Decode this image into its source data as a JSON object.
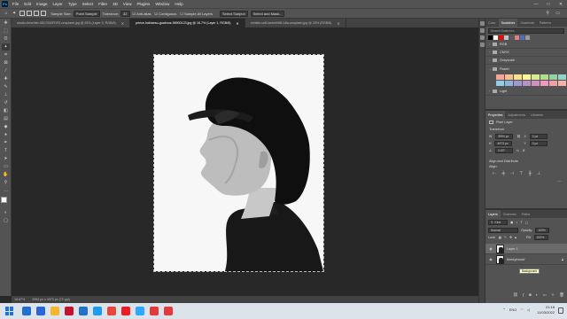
{
  "menu": {
    "app_badge": "Ps",
    "items": [
      "File",
      "Edit",
      "Image",
      "Layer",
      "Type",
      "Select",
      "Filter",
      "3D",
      "View",
      "Plugins",
      "Window",
      "Help"
    ],
    "window_controls": [
      "—",
      "□",
      "✕"
    ]
  },
  "options_bar": {
    "sample_size_label": "Sample Size:",
    "sample_size_value": "Point Sample",
    "tolerance_label": "Tolerance:",
    "tolerance_value": "32",
    "anti_alias": "Anti-alias",
    "contiguous": "Contiguous",
    "sample_all_layers": "Sample All Layers",
    "select_subject": "Select Subject",
    "select_and_mask": "Select and Mask..."
  },
  "document_tabs": [
    {
      "title": "studio-benchter-0817000FDFE-unsplash.jpg @ 25% (Layer 0, RGB/8)",
      "active": false
    },
    {
      "title": "prince-hubiaesu-gualmos-98900123.jpg @ 16.7% (Layer 1, RGB/8)",
      "active": true
    },
    {
      "title": "christie-unfl-fanbeil9f8.1dfa-unsplash.jpg @ 25% (RGB/8)",
      "active": false
    }
  ],
  "status_bar": {
    "zoom": "16.67%",
    "doc_info": "3994 px x 4973 px (72 ppi)"
  },
  "right_panels": {
    "swatches": {
      "tabs": [
        "Color",
        "Swatches",
        "Gradients",
        "Patterns"
      ],
      "active_tab": "Swatches",
      "search_placeholder": "Search Swatches",
      "recent": [
        "#000000",
        "#ffffff",
        "#ff0000",
        "#c2c2c2",
        "#5a5a5a",
        "#e08080",
        "#4f6fbf",
        "#9a9a9a"
      ],
      "groups": [
        {
          "name": "RGB",
          "expanded": false
        },
        {
          "name": "CMYK",
          "expanded": false
        },
        {
          "name": "Grayscale",
          "expanded": false
        },
        {
          "name": "Pastel",
          "expanded": true
        },
        {
          "name": "Light",
          "expanded": false
        }
      ],
      "pastel_colors": [
        "#f5a39b",
        "#f7c08a",
        "#f9e08a",
        "#fff799",
        "#d7ec8f",
        "#b3dc8e",
        "#95d1a3",
        "#93d2c8",
        "#8ecfe8",
        "#8fb3df",
        "#9d98cd",
        "#b393c6",
        "#d290c2",
        "#f198bd",
        "#f59ea8",
        "#f7b0a3"
      ]
    },
    "properties": {
      "tabs": [
        "Properties",
        "Adjustments",
        "Libraries"
      ],
      "active_tab": "Properties",
      "layer_kind": "Pixel Layer",
      "transform_title": "Transform",
      "w": "3994 px",
      "h": "4973 px",
      "x": "0 px",
      "y": "0 px",
      "angle": "0.00°",
      "align_title": "Align and Distribute",
      "align_label": "Align:"
    },
    "layers": {
      "tabs": [
        "Layers",
        "Channels",
        "Paths"
      ],
      "active_tab": "Layers",
      "kind_filter": "Kind",
      "blend_mode": "Normal",
      "opacity_label": "Opacity:",
      "opacity": "100%",
      "lock_label": "Lock:",
      "fill_label": "Fill:",
      "fill": "100%",
      "items": [
        {
          "name": "Layer 1",
          "selected": true
        },
        {
          "name": "Background",
          "selected": false
        }
      ],
      "tooltip": "Background"
    }
  },
  "taskbar": {
    "time": "21:18",
    "date": "11/03/2022",
    "tray": "ENG",
    "apps": [
      "#1f6fd1",
      "#2a66d9",
      "#f3b62d",
      "#c3142d",
      "#2472c8",
      "#1c9bf0",
      "#e8483c",
      "#ec1c24",
      "#31a8ff",
      "#e03b3b",
      "#e23b3b"
    ]
  }
}
